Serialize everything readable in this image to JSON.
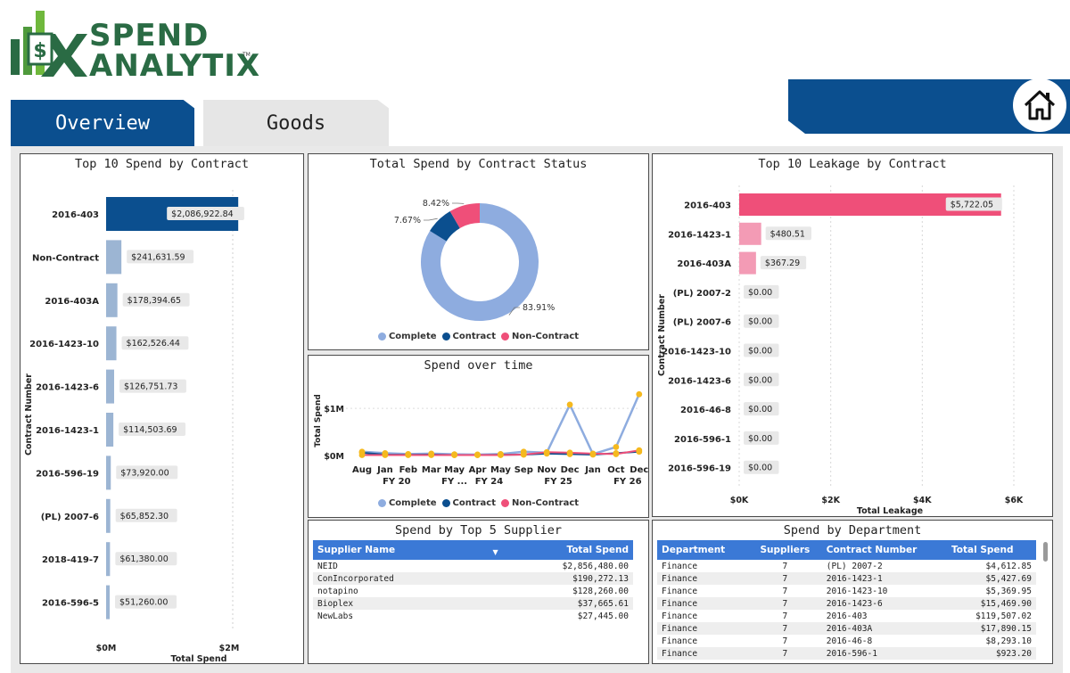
{
  "brand": {
    "line1": "SPEND",
    "line2": "ANALYTIX",
    "tm": "TM"
  },
  "tabs": [
    {
      "label": "Overview",
      "active": true
    },
    {
      "label": "Goods",
      "active": false
    }
  ],
  "colors": {
    "navy": "#0b4f8f",
    "green": "#2a6b44",
    "complete": "#8eacdf",
    "contract": "#0b4f8f",
    "non_contract": "#ef4f79",
    "header_blue": "#3b79d6"
  },
  "top_spend": {
    "title": "Top 10 Spend by Contract",
    "chart_data": {
      "type": "bar",
      "orientation": "horizontal",
      "categories": [
        "2016-403",
        "Non-Contract",
        "2016-403A",
        "2016-1423-10",
        "2016-1423-6",
        "2016-1423-1",
        "2016-596-19",
        "(PL) 2007-6",
        "2018-419-7",
        "2016-596-5"
      ],
      "values": [
        2086922.84,
        241631.59,
        178394.65,
        162526.44,
        126751.73,
        114503.69,
        73920.0,
        65852.3,
        61380.0,
        51260.0
      ],
      "labels": [
        "$2,086,922.84",
        "$241,631.59",
        "$178,394.65",
        "$162,526.44",
        "$126,751.73",
        "$114,503.69",
        "$73,920.00",
        "$65,852.30",
        "$61,380.00",
        "$51,260.00"
      ],
      "xlabel": "Total Spend",
      "ylabel": "Contract Number",
      "xlim": [
        0,
        2000000
      ],
      "xticks": [
        "$0M",
        "$2M"
      ]
    }
  },
  "contract_status": {
    "title": "Total Spend by Contract Status",
    "chart_data": {
      "type": "pie",
      "categories": [
        "Complete",
        "Contract",
        "Non-Contract"
      ],
      "values": [
        83.91,
        7.67,
        8.42
      ],
      "labels": [
        "83.91%",
        "7.67%",
        "8.42%"
      ],
      "legend": "bottom"
    }
  },
  "spend_time": {
    "title": "Spend over time",
    "chart_data": {
      "type": "line",
      "x": [
        "Aug",
        "Jan",
        "Feb",
        "Mar",
        "May",
        "Apr",
        "May",
        "Sep",
        "Nov",
        "Dec",
        "Jan",
        "Oct",
        "Dec"
      ],
      "groups": [
        "FY 20",
        "FY ...",
        "FY 24",
        "FY 25",
        "FY 26"
      ],
      "ylabel": "Total Spend",
      "yticks": [
        "$1M",
        "$0M"
      ],
      "ylim": [
        0,
        1400000
      ],
      "series": [
        {
          "name": "Complete",
          "values": [
            80000,
            50000,
            30000,
            40000,
            25000,
            20000,
            30000,
            80000,
            60000,
            1080000,
            30000,
            180000,
            1300000
          ]
        },
        {
          "name": "Contract",
          "values": [
            60000,
            20000,
            15000,
            20000,
            10000,
            10000,
            15000,
            20000,
            40000,
            30000,
            20000,
            50000,
            80000
          ]
        },
        {
          "name": "Non-Contract",
          "values": [
            10000,
            10000,
            10000,
            10000,
            10000,
            10000,
            10000,
            20000,
            70000,
            60000,
            40000,
            30000,
            110000
          ]
        }
      ],
      "legend": "bottom"
    }
  },
  "top_leakage": {
    "title": "Top 10 Leakage by Contract",
    "chart_data": {
      "type": "bar",
      "orientation": "horizontal",
      "categories": [
        "2016-403",
        "2016-1423-1",
        "2016-403A",
        "(PL) 2007-2",
        "(PL) 2007-6",
        "2016-1423-10",
        "2016-1423-6",
        "2016-46-8",
        "2016-596-1",
        "2016-596-19"
      ],
      "values": [
        5722.05,
        480.51,
        367.29,
        0,
        0,
        0,
        0,
        0,
        0,
        0
      ],
      "labels": [
        "$5,722.05",
        "$480.51",
        "$367.29",
        "$0.00",
        "$0.00",
        "$0.00",
        "$0.00",
        "$0.00",
        "$0.00",
        "$0.00"
      ],
      "xlabel": "Total Leakage",
      "ylabel": "Contract Number",
      "xlim": [
        0,
        6000
      ],
      "xticks": [
        "$0K",
        "$2K",
        "$4K",
        "$6K"
      ]
    }
  },
  "top_suppliers": {
    "title": "Spend by Top 5 Supplier",
    "columns": [
      "Supplier Name",
      "Total Spend"
    ],
    "rows": [
      [
        "NEID",
        "$2,856,480.00"
      ],
      [
        "ConIncorporated",
        "$190,272.13"
      ],
      [
        "notapino",
        "$128,260.00"
      ],
      [
        "Bioplex",
        "$37,665.61"
      ],
      [
        "NewLabs",
        "$27,445.00"
      ]
    ]
  },
  "department": {
    "title": "Spend by Department",
    "columns": [
      "Department",
      "Suppliers",
      "Contract Number",
      "Total Spend"
    ],
    "rows": [
      [
        "Finance",
        "7",
        "(PL) 2007-2",
        "$4,612.85"
      ],
      [
        "Finance",
        "7",
        "2016-1423-1",
        "$5,427.69"
      ],
      [
        "Finance",
        "7",
        "2016-1423-10",
        "$5,369.95"
      ],
      [
        "Finance",
        "7",
        "2016-1423-6",
        "$15,469.90"
      ],
      [
        "Finance",
        "7",
        "2016-403",
        "$119,507.02"
      ],
      [
        "Finance",
        "7",
        "2016-403A",
        "$17,890.15"
      ],
      [
        "Finance",
        "7",
        "2016-46-8",
        "$8,293.10"
      ],
      [
        "Finance",
        "7",
        "2016-596-1",
        "$923.20"
      ]
    ]
  }
}
